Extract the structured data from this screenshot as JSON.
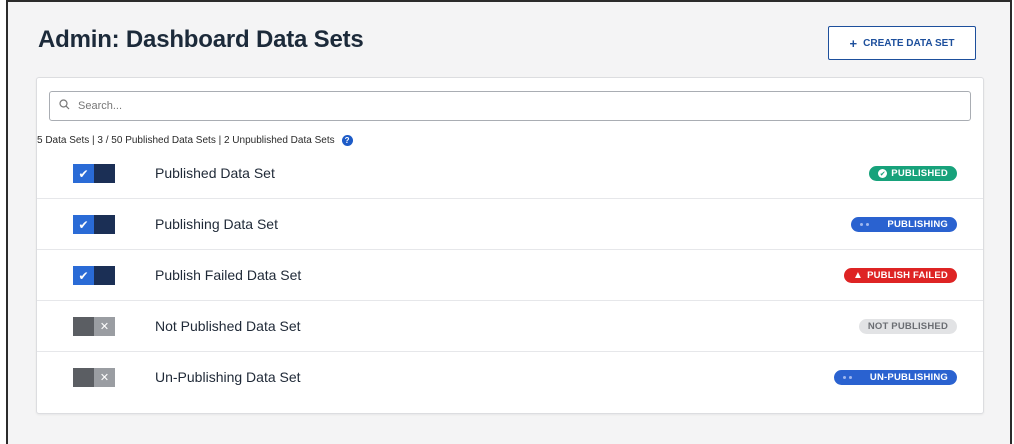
{
  "header": {
    "title": "Admin: Dashboard Data Sets",
    "create_button": {
      "icon": "plus-icon",
      "label": "CREATE DATA SET"
    }
  },
  "search": {
    "icon": "search-icon",
    "placeholder": "Search...",
    "value": ""
  },
  "summary": {
    "text": "5 Data Sets | 3 / 50 Published Data Sets | 2 Unpublished Data Sets",
    "help_icon": "question-circle-icon"
  },
  "rows": [
    {
      "label": "Published Data Set",
      "toggle": "on",
      "status": "PUBLISHED"
    },
    {
      "label": "Publishing Data Set",
      "toggle": "on",
      "status": "PUBLISHING"
    },
    {
      "label": "Publish Failed Data Set",
      "toggle": "on",
      "status": "PUBLISH FAILED"
    },
    {
      "label": "Not Published Data Set",
      "toggle": "off",
      "status": "NOT PUBLISHED"
    },
    {
      "label": "Un-Publishing Data Set",
      "toggle": "off",
      "status": "UN-PUBLISHING"
    }
  ],
  "colors": {
    "published": "#17a27b",
    "publishing": "#2a62d0",
    "failed": "#de2424",
    "not_published": "#e2e3e5",
    "toggle_on": "#2a6bd6",
    "toggle_off": "#5b5e63"
  }
}
